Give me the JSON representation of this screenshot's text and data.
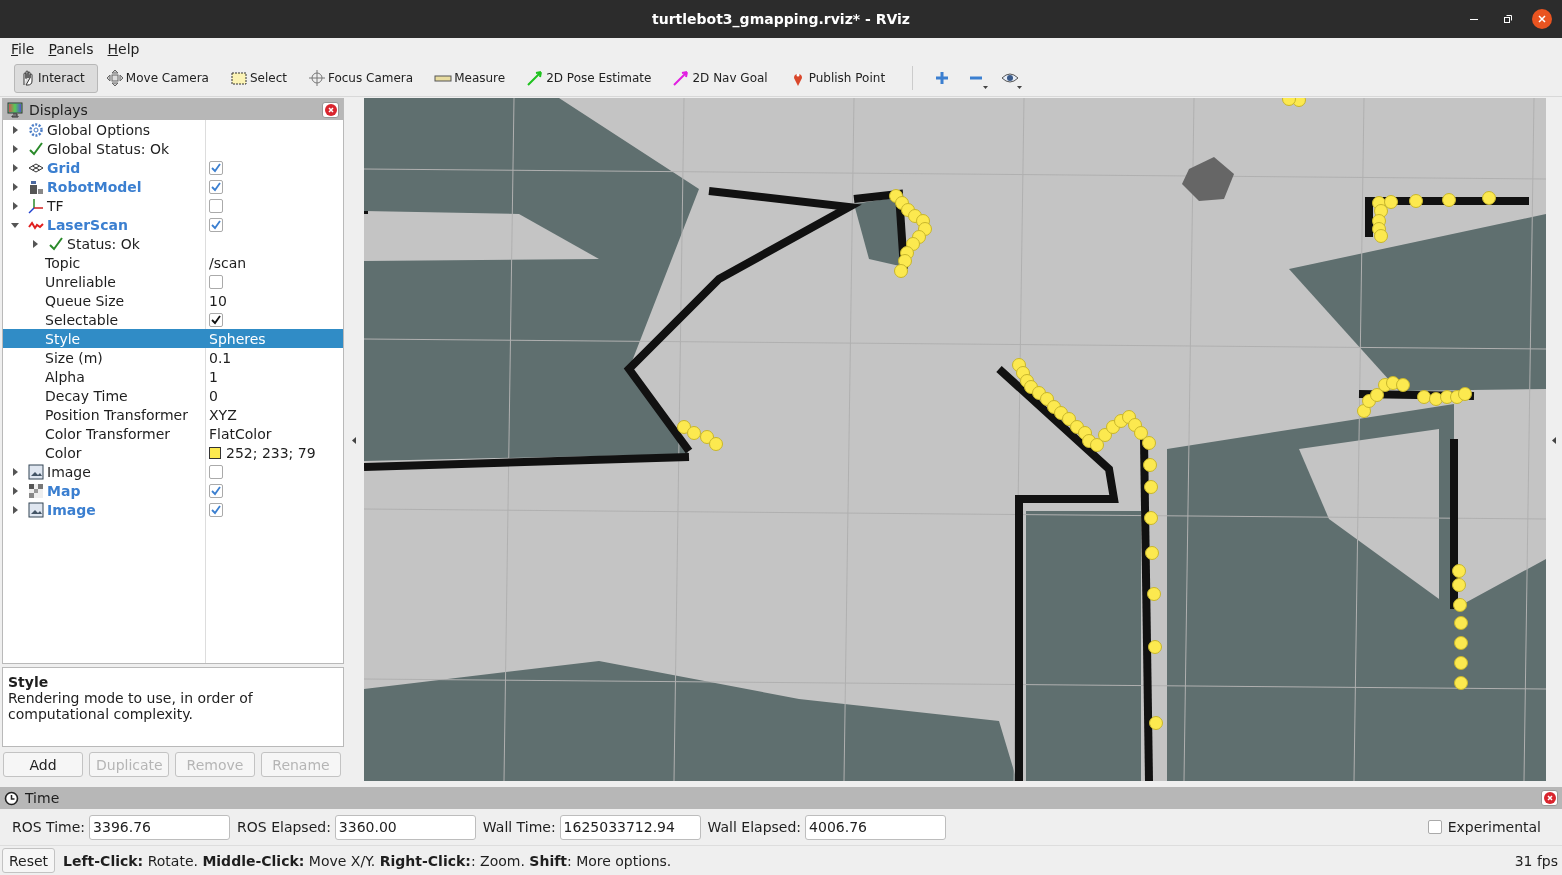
{
  "window": {
    "title": "turtlebot3_gmapping.rviz* - RViz"
  },
  "menu": [
    "File",
    "Panels",
    "Help"
  ],
  "tools": [
    {
      "label": "Interact",
      "selected": true
    },
    {
      "label": "Move Camera",
      "selected": false
    },
    {
      "label": "Select",
      "selected": false
    },
    {
      "label": "Focus Camera",
      "selected": false
    },
    {
      "label": "Measure",
      "selected": false
    },
    {
      "label": "2D Pose Estimate",
      "selected": false
    },
    {
      "label": "2D Nav Goal",
      "selected": false
    },
    {
      "label": "Publish Point",
      "selected": false
    }
  ],
  "view_buttons": [
    {
      "dropdown": false
    },
    {
      "dropdown": true
    },
    {
      "dropdown": true
    }
  ],
  "displays": {
    "title": "Displays",
    "tree": [
      {
        "kind": "display",
        "label": "Global Options",
        "expanded": false
      },
      {
        "kind": "display",
        "label": "Global Status: Ok",
        "expanded": false
      },
      {
        "kind": "display",
        "label": "Grid",
        "expanded": false,
        "checked": true,
        "selected": false
      },
      {
        "kind": "display",
        "label": "RobotModel",
        "expanded": false,
        "checked": true,
        "selected": false
      },
      {
        "kind": "display",
        "label": "TF",
        "expanded": false,
        "checked": false,
        "selected": false
      },
      {
        "kind": "display",
        "label": "LaserScan",
        "expanded": true,
        "checked": true,
        "selected": false,
        "children": [
          {
            "kind": "display",
            "label": "Status: Ok",
            "expanded": false
          },
          {
            "kind": "property",
            "label": "Topic",
            "value": "/scan",
            "selected": false
          },
          {
            "kind": "property",
            "label": "Unreliable",
            "checked": false,
            "selected": false
          },
          {
            "kind": "property",
            "label": "Queue Size",
            "value": "10",
            "selected": false
          },
          {
            "kind": "property",
            "label": "Selectable",
            "checked": true,
            "selected": false
          },
          {
            "kind": "property",
            "label": "Style",
            "value": "Spheres",
            "selected": true
          },
          {
            "kind": "property",
            "label": "Size (m)",
            "value": "0.1",
            "selected": false
          },
          {
            "kind": "property",
            "label": "Alpha",
            "value": "1",
            "selected": false
          },
          {
            "kind": "property",
            "label": "Decay Time",
            "value": "0",
            "selected": false
          },
          {
            "kind": "property",
            "label": "Position Transformer",
            "value": "XYZ",
            "selected": false
          },
          {
            "kind": "property",
            "label": "Color Transformer",
            "value": "FlatColor",
            "selected": false
          },
          {
            "kind": "property",
            "label": "Color",
            "value": "252; 233; 79",
            "color": "#fce94f",
            "selected": false
          }
        ]
      },
      {
        "kind": "display",
        "label": "Image",
        "expanded": false,
        "checked": false,
        "selected": false
      },
      {
        "kind": "display",
        "label": "Map",
        "expanded": false,
        "checked": true,
        "selected": false
      },
      {
        "kind": "display",
        "label": "Image",
        "expanded": false,
        "checked": true,
        "selected": false
      }
    ],
    "description": {
      "title": "Style",
      "text": "Rendering mode to use, in order of computational complexity."
    },
    "buttons": [
      {
        "label": "Add",
        "disabled": false
      },
      {
        "label": "Duplicate",
        "disabled": true
      },
      {
        "label": "Remove",
        "disabled": true
      },
      {
        "label": "Rename",
        "disabled": true
      }
    ]
  },
  "time": {
    "title": "Time",
    "fields": [
      {
        "label": "ROS Time:",
        "value": "3396.76"
      },
      {
        "label": "ROS Elapsed:",
        "value": "3360.00"
      },
      {
        "label": "Wall Time:",
        "value": "1625033712.94"
      },
      {
        "label": "Wall Elapsed:",
        "value": "4006.76"
      }
    ],
    "experimental": {
      "label": "Experimental",
      "checked": false
    }
  },
  "status_bar": {
    "reset": "Reset",
    "hint": "**Left-Click:** Rotate. **Middle-Click:** Move X/Y. **Right-Click:**: Zoom. **Shift**: More options.",
    "fps": "31 fps"
  }
}
